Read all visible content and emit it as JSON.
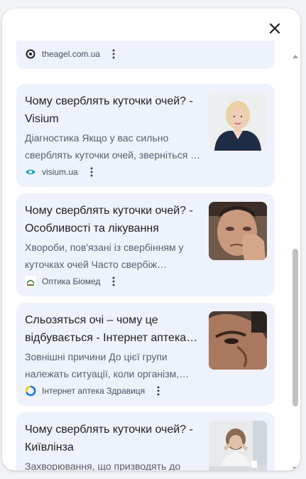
{
  "panel": {
    "close_icon": "close-icon"
  },
  "results": [
    {
      "title": "",
      "snippet": "",
      "source": "theagel.com.ua",
      "favicon": "theagel-favicon"
    },
    {
      "title": "Чому сверблять куточки очей? - Visium",
      "snippet": "Діагностика Якщо у вас сильно сверблять куточки очей, зверніться …",
      "source": "visium.ua",
      "favicon": "visium-favicon",
      "thumb": "doctor-portrait-image"
    },
    {
      "title": "Чому сверблять куточки очей? - Особливості та лікування",
      "snippet": "Хвороби, пов'язані із свербінням у куточках очей Часто свербіж…",
      "source": "Оптика Біомед",
      "favicon": "biomed-favicon",
      "thumb": "man-rubbing-eye-image"
    },
    {
      "title": "Сльозяться очі – чому це відбувається - Інтернет аптека…",
      "snippet": "Зовнішні причини До цієї групи належать ситуації, коли організм,…",
      "source": "Інтернет аптека Здравиця",
      "favicon": "zdravytsia-favicon",
      "thumb": "man-closeup-eye-image"
    },
    {
      "title": "Чому сверблять куточки очей? - Київлінза",
      "snippet": "Захворювання, що призводять до свербіння очей Однією з…",
      "source": "",
      "favicon": "",
      "thumb": "woman-at-desk-image"
    }
  ],
  "colors": {
    "card_bg": "#eef2fc",
    "title": "#1f1f1f",
    "snippet": "#5b5f67",
    "visium_teal": "#12a8b5"
  }
}
